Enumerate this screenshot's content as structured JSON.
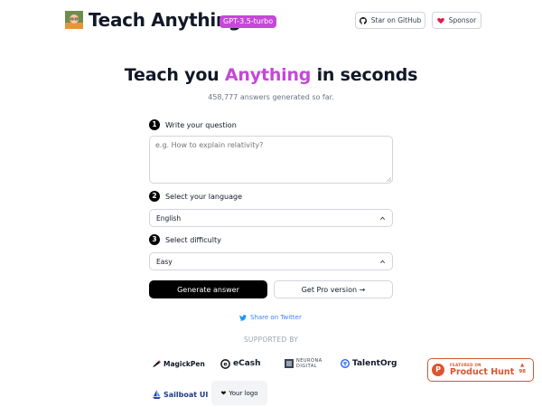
{
  "header": {
    "app_title": "Teach Anything",
    "model_badge": "GPT-3.5-turbo",
    "github_label": "Star on GitHub",
    "sponsor_label": "Sponsor"
  },
  "hero": {
    "title_before": "Teach you ",
    "title_accent": "Anything",
    "title_after": " in seconds",
    "stats": "458,777 answers generated so far."
  },
  "form": {
    "step1": {
      "num": "1",
      "label": "Write your question"
    },
    "question_placeholder": "e.g. How to explain relativity?",
    "step2": {
      "num": "2",
      "label": "Select your language"
    },
    "language_value": "English",
    "step3": {
      "num": "3",
      "label": "Select difficulty"
    },
    "difficulty_value": "Easy",
    "generate_label": "Generate answer",
    "pro_label": "Get Pro version →"
  },
  "share_label": "Share on Twitter",
  "supported_by": "SUPPORTED BY",
  "sponsors": {
    "magickpen": "MagickPen",
    "ecash": "eCash",
    "neurona_top": "NEURONA",
    "neurona_bottom": "DIGITAL",
    "talentorg": "TalentOrg",
    "sailboat": "Sailboat UI",
    "your_logo": "Your logo"
  },
  "product_hunt": {
    "featured": "FEATURED ON",
    "name": "Product Hunt",
    "votes": "98"
  },
  "colors": {
    "accent": "#c548d8",
    "primary_button": "#000000",
    "product_hunt": "#da552f",
    "twitter": "#3b82f6"
  }
}
